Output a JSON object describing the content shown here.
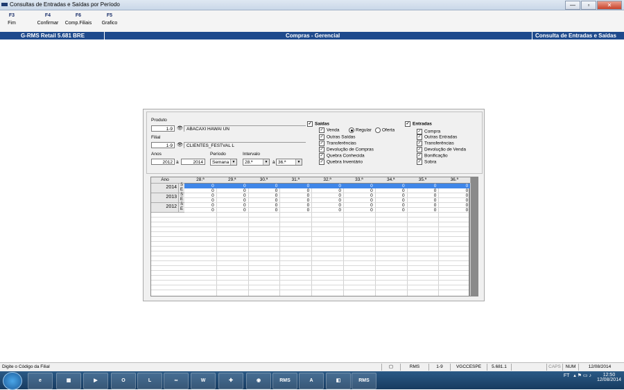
{
  "window": {
    "title": "Consultas de Entradas e Saídas por Período",
    "buttons": [
      "—",
      "▫",
      "✕"
    ]
  },
  "toolbar": {
    "keys": [
      {
        "key": "F3",
        "label": "Fim"
      },
      {
        "key": "F4",
        "label": "Confirmar"
      },
      {
        "key": "F6",
        "label": "Comp.Filiais"
      },
      {
        "key": "F5",
        "label": "Grafico"
      }
    ]
  },
  "band": {
    "left": "G-RMS Retail 5.681 BRE",
    "center": "Compras - Gerencial",
    "right": "Consulta de Entradas e Saídas"
  },
  "filters": {
    "produto_label": "Produto",
    "produto_code": "1-9",
    "produto_name": "ABACAXI HAWAI UN",
    "filial_label": "Filial",
    "filial_code": "1-9",
    "filial_name": "CLIENTES_FESTVAL L",
    "anos_label": "Anos",
    "ano_from": "2012",
    "ano_sep": "à",
    "ano_to": "2014",
    "periodo_label": "Período",
    "periodo_value": "Semana",
    "intervalo_label": "Intervalo",
    "intervalo_from": "28.ª",
    "intervalo_sep": "à",
    "intervalo_to": "36.ª"
  },
  "saidas": {
    "title": "Saídas",
    "checked": "☑",
    "venda": "Venda",
    "regular": "Regular",
    "oferta": "Oferta",
    "items": [
      "Outras Saídas",
      "Transferências",
      "Devolução de Compras",
      "Quebra Conhecida",
      "Quebra Inventário"
    ]
  },
  "entradas": {
    "title": "Entradas",
    "items": [
      "Compra",
      "Outras Entradas",
      "Transferências",
      "Devolução de Venda",
      "Bonificação",
      "Sobra"
    ]
  },
  "grid": {
    "ano_header": "Ano",
    "weeks": [
      "28.ª",
      "29.ª",
      "30.ª",
      "31.ª",
      "32.ª",
      "33.ª",
      "34.ª",
      "35.ª",
      "36.ª"
    ],
    "years": [
      {
        "year": "2014",
        "s": [
          "0",
          "0",
          "0",
          "0",
          "0",
          "0",
          "0",
          "0",
          "0"
        ],
        "e": [
          "0",
          "0",
          "0",
          "0",
          "0",
          "0",
          "0",
          "0",
          "0"
        ]
      },
      {
        "year": "2013",
        "s": [
          "0",
          "0",
          "0",
          "0",
          "0",
          "0",
          "0",
          "0",
          "0"
        ],
        "e": [
          "0",
          "0",
          "0",
          "0",
          "0",
          "0",
          "0",
          "0",
          "0"
        ]
      },
      {
        "year": "2012",
        "s": [
          "0",
          "0",
          "0",
          "0",
          "0",
          "0",
          "0",
          "0",
          "0"
        ],
        "e": [
          "0",
          "0",
          "0",
          "0",
          "0",
          "0",
          "0",
          "0",
          "0"
        ]
      }
    ],
    "s_label": "S",
    "e_label": "E"
  },
  "statusbar": {
    "message": "Digite o Código da Filial",
    "system": "RMS",
    "filial": "1-9",
    "user": "VGCCESPE",
    "version": "5.681.1",
    "caps": "CAPS",
    "num": "NUM",
    "date": "12/08/2014"
  },
  "taskbar": {
    "apps": [
      "e",
      "▦",
      "▶",
      "O",
      "L",
      "∞",
      "W",
      "✚",
      "◉",
      "RMS",
      "A",
      "◧",
      "RMS"
    ],
    "tray_lang": "FT",
    "time": "12:50",
    "date": "12/08/2014"
  },
  "colors": {
    "band": "#1e4a8c",
    "highlight": "#3f86e8"
  }
}
